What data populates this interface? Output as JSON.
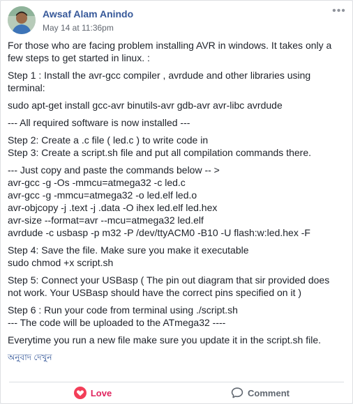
{
  "post": {
    "author": "Awsaf Alam Anindo",
    "timestamp": "May 14 at 11:36pm",
    "paragraphs": [
      [
        "For those who are facing problem installing AVR in windows. It takes only a few steps to get started in linux. :"
      ],
      [
        "Step 1 : Install the avr-gcc compiler , avrdude and other libraries using terminal:"
      ],
      [
        "sudo apt-get install gcc-avr binutils-avr gdb-avr avr-libc avrdude"
      ],
      [
        "--- All required software is now installed ---"
      ],
      [
        "Step 2: Create a .c file ( led.c ) to write code in",
        "Step 3: Create a script.sh file and put all compilation commands there."
      ],
      [
        "--- Just copy and paste the commands below -- >",
        "avr-gcc -g -Os -mmcu=atmega32 -c led.c",
        "avr-gcc -g -mmcu=atmega32 -o led.elf led.o",
        "avr-objcopy -j .text -j .data -O ihex led.elf led.hex",
        "avr-size --format=avr --mcu=atmega32 led.elf",
        "avrdude -c usbasp -p m32 -P /dev/ttyACM0 -B10 -U flash:w:led.hex -F"
      ],
      [
        "Step 4: Save the file. Make sure you make it executable",
        "sudo chmod +x script.sh"
      ],
      [
        "Step 5: Connect your USBasp ( The pin out diagram that sir provided does not work. Your USBasp should have the correct pins specified on it )"
      ],
      [
        "Step 6 : Run your code from terminal using ./script.sh",
        "--- The code will be uploaded to the ATmega32 ----"
      ],
      [
        "Everytime you run a new file make sure you update it in the script.sh file."
      ]
    ],
    "translate_link": "অনুবাদ দেখুন"
  },
  "actions": {
    "love_label": "Love",
    "comment_label": "Comment"
  },
  "colors": {
    "author": "#365899",
    "love": "#e0245e",
    "muted": "#606770"
  },
  "icons": {
    "love": "heart-icon",
    "comment": "comment-icon",
    "more": "more-options-icon"
  }
}
